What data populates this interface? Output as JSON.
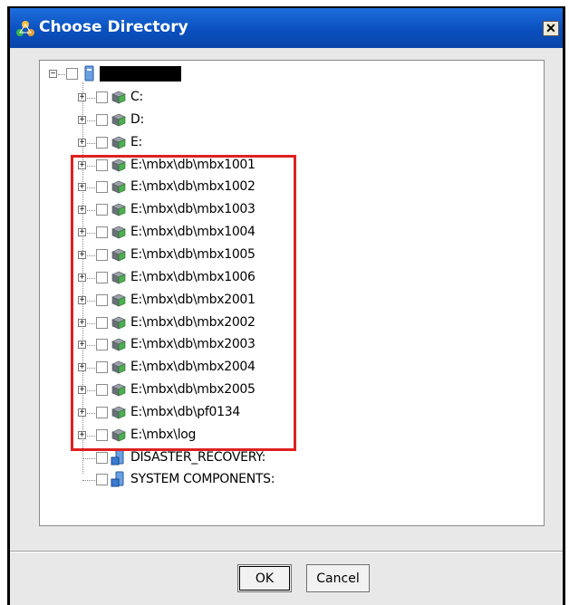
{
  "dialog": {
    "title": "Choose Directory",
    "close_glyph": "✕",
    "ok_label": "OK",
    "cancel_label": "Cancel"
  },
  "tree": {
    "root": {
      "icon": "computer-icon",
      "label_redacted": true
    },
    "children": [
      {
        "label": "C:",
        "icon": "drive-icon"
      },
      {
        "label": "D:",
        "icon": "drive-icon"
      },
      {
        "label": "E:",
        "icon": "drive-icon"
      },
      {
        "label": "E:\\mbx\\db\\mbx1001",
        "icon": "drive-icon"
      },
      {
        "label": "E:\\mbx\\db\\mbx1002",
        "icon": "drive-icon"
      },
      {
        "label": "E:\\mbx\\db\\mbx1003",
        "icon": "drive-icon"
      },
      {
        "label": "E:\\mbx\\db\\mbx1004",
        "icon": "drive-icon"
      },
      {
        "label": "E:\\mbx\\db\\mbx1005",
        "icon": "drive-icon"
      },
      {
        "label": "E:\\mbx\\db\\mbx1006",
        "icon": "drive-icon"
      },
      {
        "label": "E:\\mbx\\db\\mbx2001",
        "icon": "drive-icon"
      },
      {
        "label": "E:\\mbx\\db\\mbx2002",
        "icon": "drive-icon"
      },
      {
        "label": "E:\\mbx\\db\\mbx2003",
        "icon": "drive-icon"
      },
      {
        "label": "E:\\mbx\\db\\mbx2004",
        "icon": "drive-icon"
      },
      {
        "label": "E:\\mbx\\db\\mbx2005",
        "icon": "drive-icon"
      },
      {
        "label": "E:\\mbx\\db\\pf0134",
        "icon": "drive-icon"
      },
      {
        "label": "E:\\mbx\\log",
        "icon": "drive-icon"
      },
      {
        "label": "DISASTER_RECOVERY:",
        "icon": "system-icon"
      },
      {
        "label": "SYSTEM COMPONENTS:",
        "icon": "system-icon"
      }
    ]
  },
  "colors": {
    "titlebar": "#0a4fbf",
    "highlight": "#e02020"
  }
}
